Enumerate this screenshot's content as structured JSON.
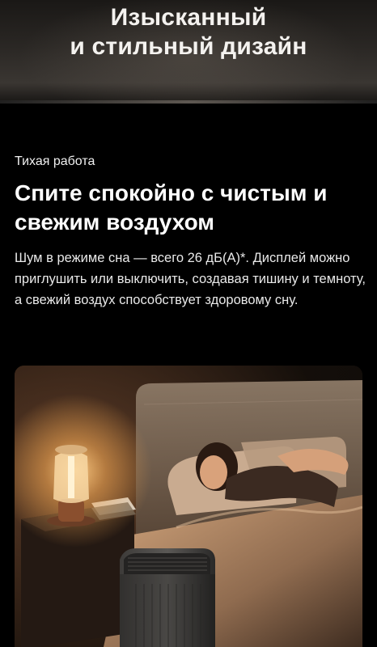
{
  "hero": {
    "title_line1": "Изысканный",
    "title_line2": "и стильный дизайн"
  },
  "section": {
    "kicker": "Тихая работа",
    "headline": "Спите спокойно с чистым и свежим воздухом",
    "body": "Шум в режиме сна — всего 26 дБ(А)*. Дисплей можно приглушить или выключить, создавая тишину и темноту, а свежий воздух способствует здоровому сну."
  },
  "colors": {
    "background": "#000000",
    "text": "#ffffff",
    "lamp_glow": "#f2b66a"
  }
}
